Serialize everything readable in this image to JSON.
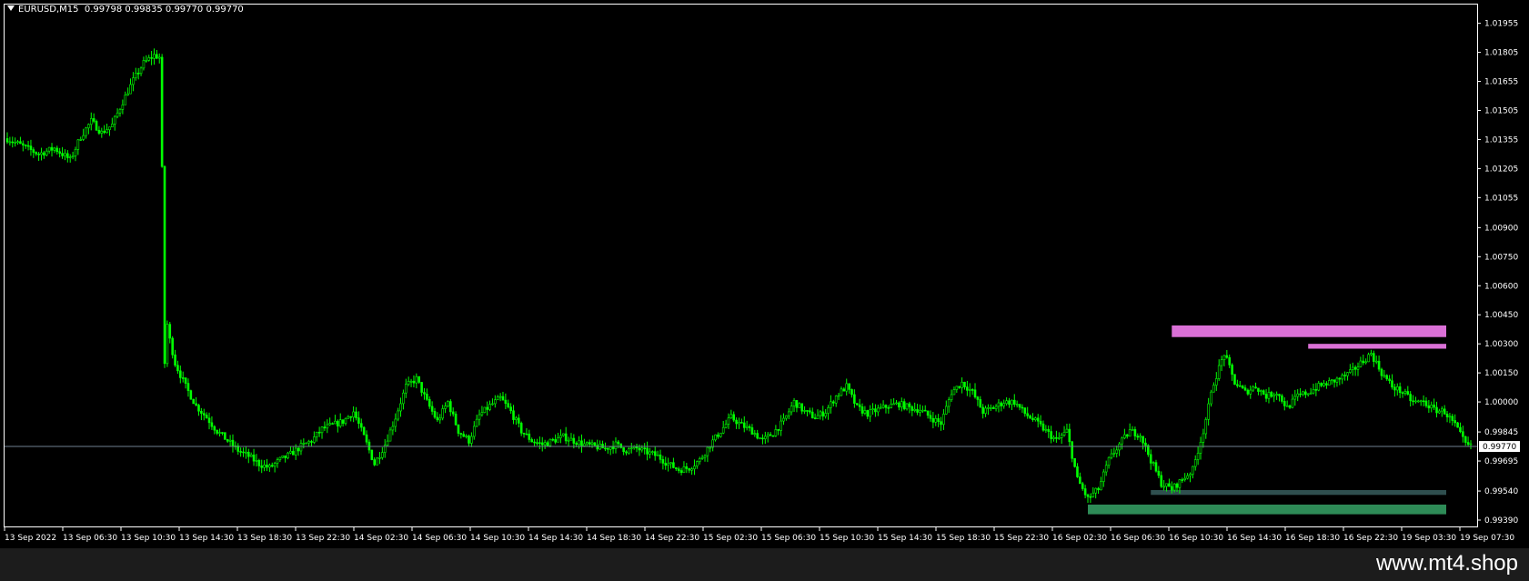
{
  "chart_header": {
    "symbol_label": "EURUSD,M15",
    "ohlc_text": "0.99798 0.99835 0.99770 0.99770"
  },
  "watermark": "www.mt4.shop",
  "colors": {
    "background": "#000000",
    "candle": "#00ff00",
    "current_price_line": "#708090",
    "supply_zone": "#da70d6",
    "demand_zone_dark": "#2e8b57",
    "demand_zone_light": "#2f4f4f",
    "price_tag_bg": "#ffffff",
    "price_tag_text": "#000000"
  },
  "chart_data": {
    "type": "candlestick",
    "symbol": "EURUSD",
    "timeframe": "M15",
    "current_price": 0.9977,
    "ylim": [
      0.9939,
      1.02005
    ],
    "y_ticks": [
      1.01955,
      1.01805,
      1.01655,
      1.01505,
      1.01355,
      1.01205,
      1.01055,
      1.009,
      1.0075,
      1.006,
      1.0045,
      1.003,
      1.0015,
      1.0,
      0.99845,
      0.99695,
      0.9954,
      0.9939
    ],
    "y_tick_labels": [
      "1.01955",
      "1.01805",
      "1.01655",
      "1.01505",
      "1.01355",
      "1.01205",
      "1.01055",
      "1.00900",
      "1.00750",
      "1.00600",
      "1.00450",
      "1.00300",
      "1.00150",
      "1.00000",
      "0.99845",
      "0.99695",
      "0.99540",
      "0.99390"
    ],
    "x_tick_labels": [
      "13 Sep 2022",
      "13 Sep 06:30",
      "13 Sep 10:30",
      "13 Sep 14:30",
      "13 Sep 18:30",
      "13 Sep 22:30",
      "14 Sep 02:30",
      "14 Sep 06:30",
      "14 Sep 10:30",
      "14 Sep 14:30",
      "14 Sep 18:30",
      "14 Sep 22:30",
      "15 Sep 02:30",
      "15 Sep 06:30",
      "15 Sep 10:30",
      "15 Sep 14:30",
      "15 Sep 18:30",
      "15 Sep 22:30",
      "16 Sep 02:30",
      "16 Sep 06:30",
      "16 Sep 10:30",
      "16 Sep 14:30",
      "16 Sep 18:30",
      "16 Sep 22:30",
      "19 Sep 03:30",
      "19 Sep 07:30"
    ],
    "close_path": [
      [
        0,
        1.0136
      ],
      [
        6,
        1.0132
      ],
      [
        12,
        1.0128
      ],
      [
        18,
        1.0131
      ],
      [
        24,
        1.0125
      ],
      [
        28,
        1.0137
      ],
      [
        32,
        1.0145
      ],
      [
        36,
        1.0139
      ],
      [
        40,
        1.0143
      ],
      [
        44,
        1.0155
      ],
      [
        48,
        1.0166
      ],
      [
        52,
        1.0175
      ],
      [
        56,
        1.0179
      ],
      [
        58,
        1.0178
      ],
      [
        59,
        1.012
      ],
      [
        60,
        1.002
      ],
      [
        61,
        1.004
      ],
      [
        62,
        1.0032
      ],
      [
        64,
        1.002
      ],
      [
        68,
        1.0008
      ],
      [
        72,
        0.9998
      ],
      [
        76,
        0.9992
      ],
      [
        80,
        0.9985
      ],
      [
        84,
        0.998
      ],
      [
        88,
        0.9975
      ],
      [
        92,
        0.9972
      ],
      [
        96,
        0.9968
      ],
      [
        100,
        0.9966
      ],
      [
        104,
        0.997
      ],
      [
        108,
        0.9973
      ],
      [
        112,
        0.9977
      ],
      [
        116,
        0.998
      ],
      [
        120,
        0.9986
      ],
      [
        124,
        0.9988
      ],
      [
        128,
        0.999
      ],
      [
        132,
        0.9995
      ],
      [
        136,
        0.9982
      ],
      [
        140,
        0.9968
      ],
      [
        144,
        0.9978
      ],
      [
        148,
        0.9992
      ],
      [
        152,
        1.0008
      ],
      [
        156,
        1.0012
      ],
      [
        160,
        1.0
      ],
      [
        164,
        0.999
      ],
      [
        168,
        1.0
      ],
      [
        172,
        0.9985
      ],
      [
        176,
        0.998
      ],
      [
        180,
        0.9993
      ],
      [
        184,
        0.9998
      ],
      [
        188,
        1.0002
      ],
      [
        192,
        0.9995
      ],
      [
        196,
        0.9985
      ],
      [
        200,
        0.998
      ],
      [
        204,
        0.9978
      ],
      [
        208,
        0.998
      ],
      [
        212,
        0.9982
      ],
      [
        216,
        0.998
      ],
      [
        220,
        0.9978
      ],
      [
        224,
        0.9977
      ],
      [
        228,
        0.9976
      ],
      [
        232,
        0.9978
      ],
      [
        236,
        0.9975
      ],
      [
        240,
        0.9976
      ],
      [
        244,
        0.9974
      ],
      [
        248,
        0.9972
      ],
      [
        252,
        0.9968
      ],
      [
        256,
        0.9965
      ],
      [
        260,
        0.9966
      ],
      [
        264,
        0.997
      ],
      [
        268,
        0.9978
      ],
      [
        272,
        0.9985
      ],
      [
        276,
        0.9992
      ],
      [
        280,
        0.9988
      ],
      [
        284,
        0.9985
      ],
      [
        288,
        0.998
      ],
      [
        292,
        0.9984
      ],
      [
        296,
        0.999
      ],
      [
        300,
        1.0
      ],
      [
        304,
        0.9995
      ],
      [
        308,
        0.9992
      ],
      [
        312,
        0.9995
      ],
      [
        316,
        1.0003
      ],
      [
        320,
        1.0008
      ],
      [
        324,
        0.9997
      ],
      [
        328,
        0.9994
      ],
      [
        332,
        0.9996
      ],
      [
        336,
        0.9998
      ],
      [
        340,
        0.9999
      ],
      [
        344,
        0.9997
      ],
      [
        348,
        0.9996
      ],
      [
        352,
        0.9992
      ],
      [
        356,
        0.9989
      ],
      [
        360,
        1.0005
      ],
      [
        364,
        1.001
      ],
      [
        368,
        1.0005
      ],
      [
        372,
        0.9995
      ],
      [
        376,
        0.9997
      ],
      [
        380,
        1.0
      ],
      [
        384,
        1.0
      ],
      [
        388,
        0.9994
      ],
      [
        392,
        0.999
      ],
      [
        396,
        0.9985
      ],
      [
        400,
        0.998
      ],
      [
        404,
        0.9985
      ],
      [
        408,
        0.996
      ],
      [
        412,
        0.995
      ],
      [
        416,
        0.9955
      ],
      [
        420,
        0.997
      ],
      [
        424,
        0.9978
      ],
      [
        428,
        0.9985
      ],
      [
        432,
        0.9983
      ],
      [
        436,
        0.997
      ],
      [
        440,
        0.9958
      ],
      [
        444,
        0.9955
      ],
      [
        448,
        0.996
      ],
      [
        452,
        0.9965
      ],
      [
        456,
        0.9985
      ],
      [
        460,
        1.001
      ],
      [
        464,
        1.0025
      ],
      [
        468,
        1.001
      ],
      [
        472,
        1.0005
      ],
      [
        476,
        1.0008
      ],
      [
        480,
        1.0003
      ],
      [
        484,
        1.0005
      ],
      [
        488,
        0.9997
      ],
      [
        492,
        1.0003
      ],
      [
        496,
        1.0005
      ],
      [
        500,
        1.0008
      ],
      [
        504,
        1.001
      ],
      [
        508,
        1.0012
      ],
      [
        512,
        1.0015
      ],
      [
        516,
        1.002
      ],
      [
        520,
        1.0025
      ],
      [
        524,
        1.0015
      ],
      [
        528,
        1.0008
      ],
      [
        532,
        1.0005
      ],
      [
        536,
        1.0
      ],
      [
        540,
        1.0
      ],
      [
        544,
        0.9996
      ],
      [
        548,
        0.9995
      ],
      [
        552,
        0.9988
      ],
      [
        556,
        0.9978
      ],
      [
        558,
        0.9977
      ]
    ],
    "zones": [
      {
        "type": "supply",
        "top": 1.00395,
        "bottom": 1.00335,
        "start_bar": 444
      },
      {
        "type": "supply",
        "top": 1.003,
        "bottom": 1.00275,
        "start_bar": 496
      },
      {
        "type": "demand",
        "top": 0.99545,
        "bottom": 0.9952,
        "start_bar": 436
      },
      {
        "type": "demand",
        "top": 0.9947,
        "bottom": 0.9942,
        "start_bar": 412
      }
    ],
    "grid": false,
    "legend": "none"
  }
}
